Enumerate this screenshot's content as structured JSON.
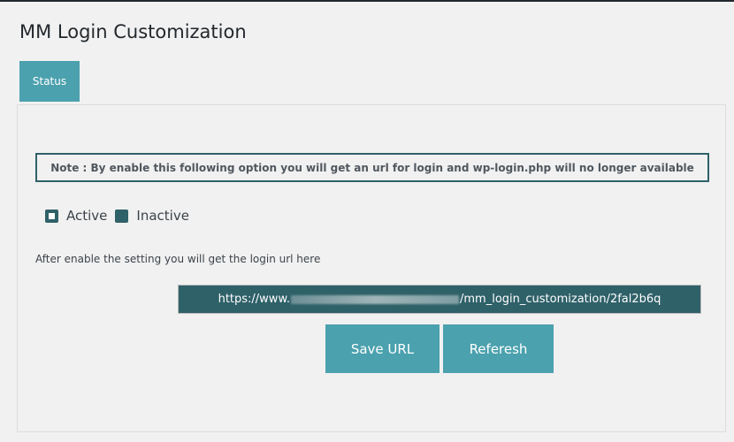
{
  "page": {
    "title": "MM Login Customization"
  },
  "tabs": [
    {
      "label": "Status",
      "active": true
    }
  ],
  "note": "Note : By enable this following option you will get an url for login and wp-login.php will no longer available",
  "status_options": [
    {
      "label": "Active",
      "selected": true
    },
    {
      "label": "Inactive",
      "selected": false
    }
  ],
  "hint": "After enable the setting you will get the login url here",
  "login_url": {
    "prefix": "https://www.",
    "suffix": "/mm_login_customization/2fal2b6q",
    "middle_redacted": true
  },
  "buttons": {
    "save": "Save URL",
    "refresh": "Referesh"
  },
  "colors": {
    "accent": "#4ba1ae",
    "dark": "#2f6169",
    "background": "#f1f1f1"
  }
}
